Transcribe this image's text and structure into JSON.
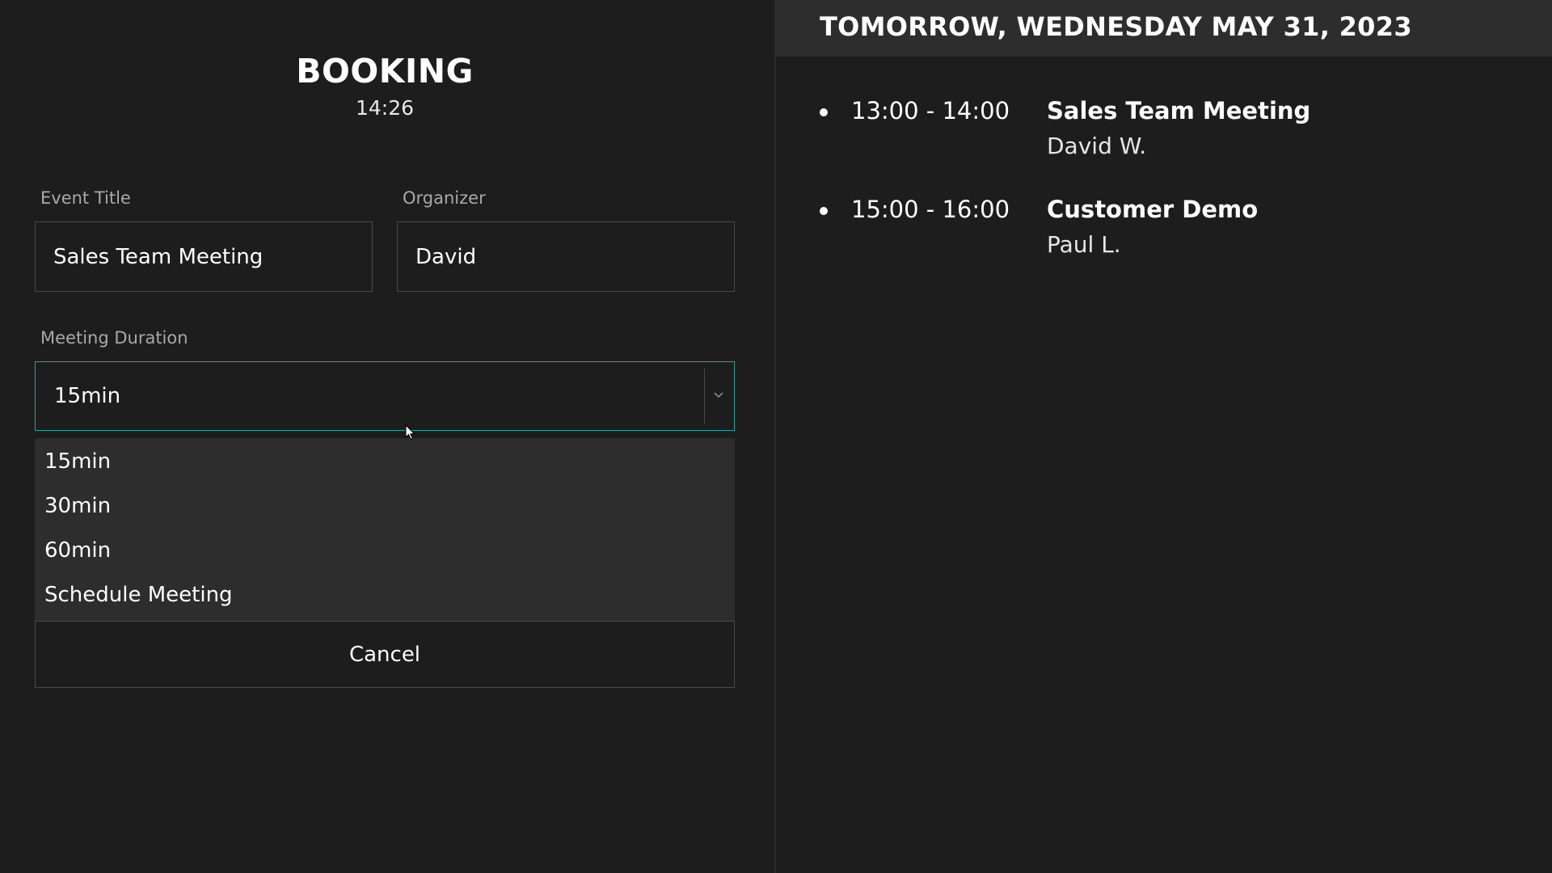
{
  "booking": {
    "title": "BOOKING",
    "clock": "14:26",
    "event_title": {
      "label": "Event Title",
      "value": "Sales Team Meeting"
    },
    "organizer": {
      "label": "Organizer",
      "value": "David"
    },
    "duration": {
      "label": "Meeting Duration",
      "selected": "15min",
      "options": [
        "15min",
        "30min",
        "60min",
        "Schedule Meeting"
      ]
    },
    "cancel_label": "Cancel"
  },
  "schedule": {
    "date_heading": "TOMORROW, WEDNESDAY MAY 31, 2023",
    "events": [
      {
        "time": "13:00 - 14:00",
        "title": "Sales Team Meeting",
        "organizer": "David W."
      },
      {
        "time": "15:00 - 16:00",
        "title": "Customer Demo",
        "organizer": "Paul L."
      }
    ]
  },
  "colors": {
    "accent": "#26a69a",
    "background": "#1d1d1d",
    "panel": "#2d2d2d",
    "border": "#4a4a4a"
  },
  "icons": {
    "dropdown": "chevron-down-icon",
    "cursor": "mouse-pointer-icon",
    "bullet": "bullet-icon"
  }
}
